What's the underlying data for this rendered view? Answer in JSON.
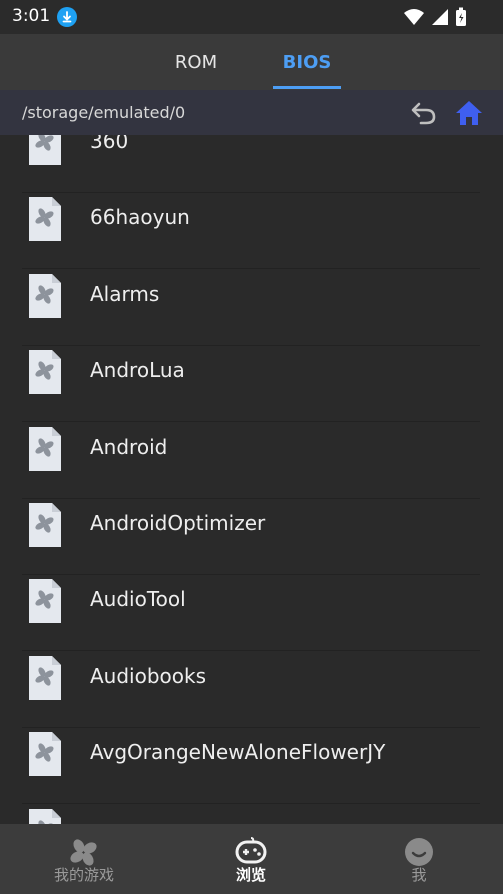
{
  "status_bar": {
    "time": "3:01"
  },
  "tabs": [
    {
      "label": "ROM",
      "active": false
    },
    {
      "label": "BIOS",
      "active": true
    }
  ],
  "path_bar": {
    "path": "/storage/emulated/0"
  },
  "files": [
    "360",
    "66haoyun",
    "Alarms",
    "AndroLua",
    "Android",
    "AndroidOptimizer",
    "AudioTool",
    "Audiobooks",
    "AvgOrangeNewAloneFlowerJY"
  ],
  "bottom_nav": [
    {
      "label": "我的游戏",
      "active": false
    },
    {
      "label": "浏览",
      "active": true
    },
    {
      "label": "我",
      "active": false
    }
  ],
  "colors": {
    "accent": "#4d9ef4",
    "home_icon": "#3f5ff0",
    "download_badge": "#1ea1f3"
  }
}
